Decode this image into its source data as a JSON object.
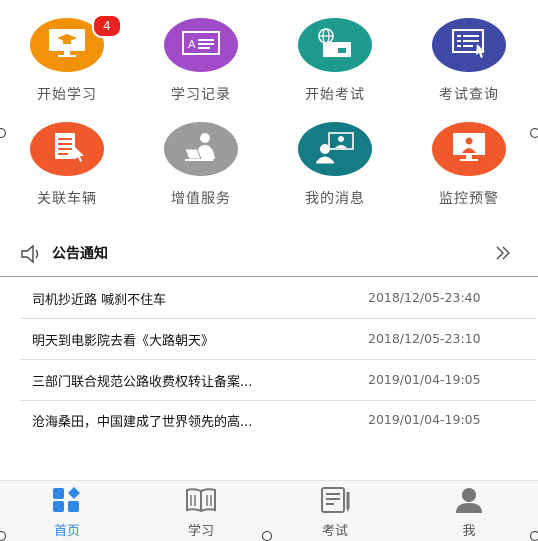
{
  "colors": {
    "orange": "#f2920b",
    "purple": "#a04bc8",
    "teal": "#1e9b8e",
    "indigo": "#3f4aa6",
    "red_orange": "#f0592b",
    "gray": "#9b9b9b",
    "dark_teal": "#157c86",
    "active_tab": "#2f86e4",
    "badge": "#e8231f"
  },
  "grid": [
    {
      "label": "开始学习",
      "icon": "monitor-graduation-cap-icon",
      "color": "#f2920b",
      "badge": "4"
    },
    {
      "label": "学习记录",
      "icon": "id-card-icon",
      "color": "#a04bc8"
    },
    {
      "label": "开始考试",
      "icon": "globe-exam-card-icon",
      "color": "#1e9b8e"
    },
    {
      "label": "考试查询",
      "icon": "document-cursor-icon",
      "color": "#3f4aa6"
    },
    {
      "label": "关联车辆",
      "icon": "document-pointer-icon",
      "color": "#f0592b"
    },
    {
      "label": "增值服务",
      "icon": "person-laptop-icon",
      "color": "#9b9b9b"
    },
    {
      "label": "我的消息",
      "icon": "video-call-icon",
      "color": "#157c86"
    },
    {
      "label": "监控预警",
      "icon": "monitor-person-icon",
      "color": "#f0592b"
    }
  ],
  "notice": {
    "title": "公告通知",
    "items": [
      {
        "title": "司机抄近路 喊刹不住车",
        "time": "2018/12/05-23:40"
      },
      {
        "title": "明天到电影院去看《大路朝天》",
        "time": "2018/12/05-23:10"
      },
      {
        "title": "三部门联合规范公路收费权转让备案...",
        "time": "2019/01/04-19:05"
      },
      {
        "title": "沧海桑田，中国建成了世界领先的高...",
        "time": "2019/01/04-19:05"
      }
    ]
  },
  "tabs": [
    {
      "label": "首页",
      "icon": "home-grid-icon",
      "active": true
    },
    {
      "label": "学习",
      "icon": "book-icon",
      "active": false
    },
    {
      "label": "考试",
      "icon": "exam-paper-icon",
      "active": false
    },
    {
      "label": "我",
      "icon": "person-icon",
      "active": false
    }
  ]
}
